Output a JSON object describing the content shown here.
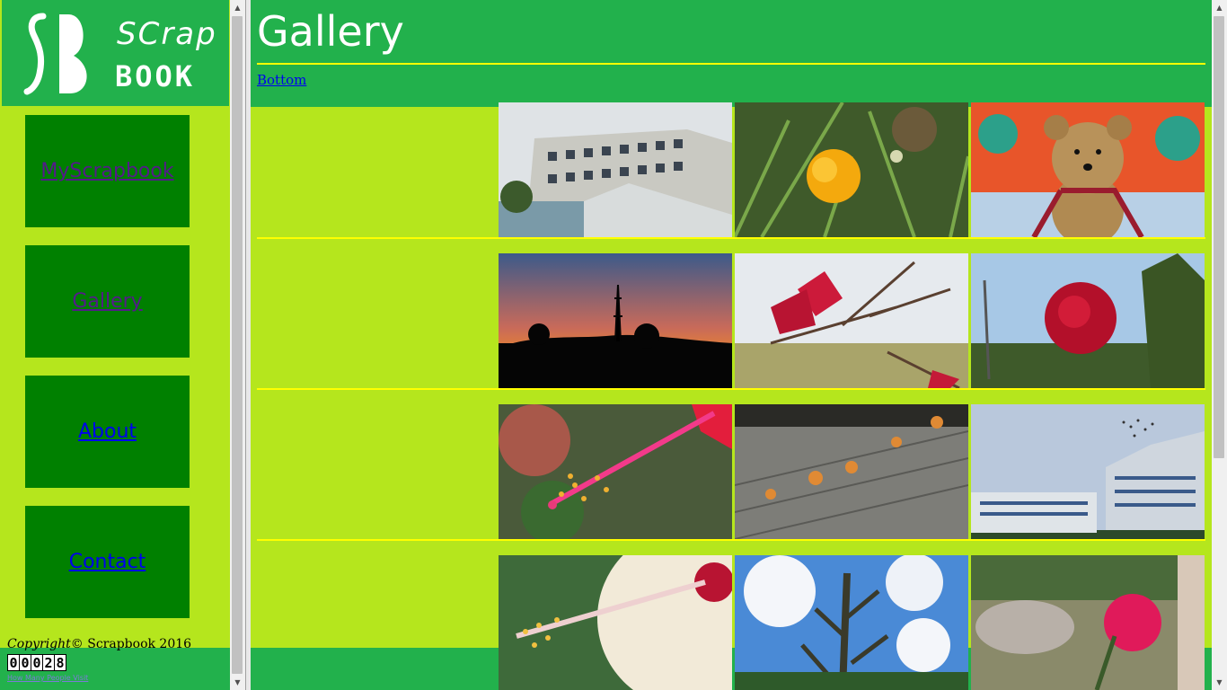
{
  "logo": {
    "line1": "SCrap",
    "line2": "BOOK"
  },
  "nav": [
    {
      "label": "MyScrapbook",
      "visited": true
    },
    {
      "label": "Gallery",
      "visited": true
    },
    {
      "label": "About",
      "visited": false
    },
    {
      "label": "Contact",
      "visited": false
    }
  ],
  "footer": {
    "copyright_word": "Copyright",
    "copyright_rest": "© Scrapbook 2016",
    "counter_digits": [
      "0",
      "0",
      "0",
      "2",
      "8"
    ],
    "counter_link": "How Many People Visit"
  },
  "page": {
    "title": "Gallery",
    "bottom_link": "Bottom"
  },
  "colors": {
    "lime": "#b5e61d",
    "green": "#22b14c",
    "dark_green": "#008000",
    "yellow": "#ffff00"
  },
  "photos": [
    {
      "name": "building-photo"
    },
    {
      "name": "yellow-flower-photo"
    },
    {
      "name": "teddy-bear-photo"
    },
    {
      "name": "sunset-tower-photo"
    },
    {
      "name": "red-flower-branch-photo"
    },
    {
      "name": "red-rose-photo"
    },
    {
      "name": "hibiscus-stamen-photo"
    },
    {
      "name": "mushrooms-on-wood-photo"
    },
    {
      "name": "campus-building-birds-photo"
    },
    {
      "name": "white-hibiscus-photo"
    },
    {
      "name": "plant-sky-photo"
    },
    {
      "name": "pink-rose-bud-photo"
    }
  ]
}
